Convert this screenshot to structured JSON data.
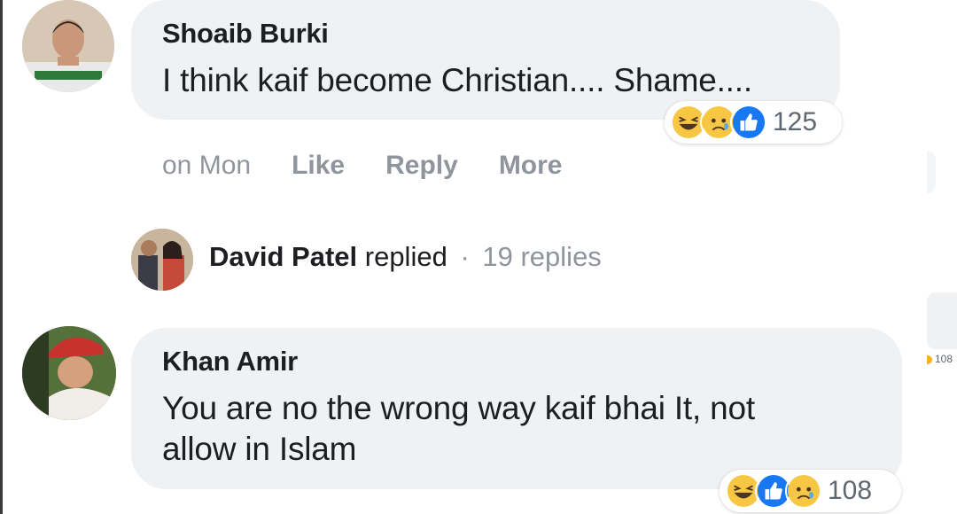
{
  "comments": [
    {
      "author": "Shoaib Burki",
      "text": "I think kaif become Christian.... Shame....",
      "reactions": {
        "icons": [
          "haha-icon",
          "sad-icon",
          "like-icon"
        ],
        "count": "125"
      },
      "timestamp": "on Mon",
      "actions": {
        "like": "Like",
        "reply": "Reply",
        "more": "More"
      }
    },
    {
      "author": "Khan Amir",
      "text_line1": "You are no the wrong way kaif bhai It, not",
      "text_line2": "allow in Islam",
      "reactions": {
        "icons": [
          "haha-icon",
          "like-icon",
          "sad-icon"
        ],
        "count": "108"
      }
    }
  ],
  "reply_summary": {
    "name": "David Patel",
    "verb": "replied",
    "separator": "·",
    "count_text": "19 replies"
  },
  "edge_reaction_count": "108",
  "colors": {
    "bubble": "#eff1f3",
    "text": "#1c1e21",
    "muted": "#90949c",
    "like_blue": "#1877f2",
    "emoji_yellow": "#f7b125"
  }
}
